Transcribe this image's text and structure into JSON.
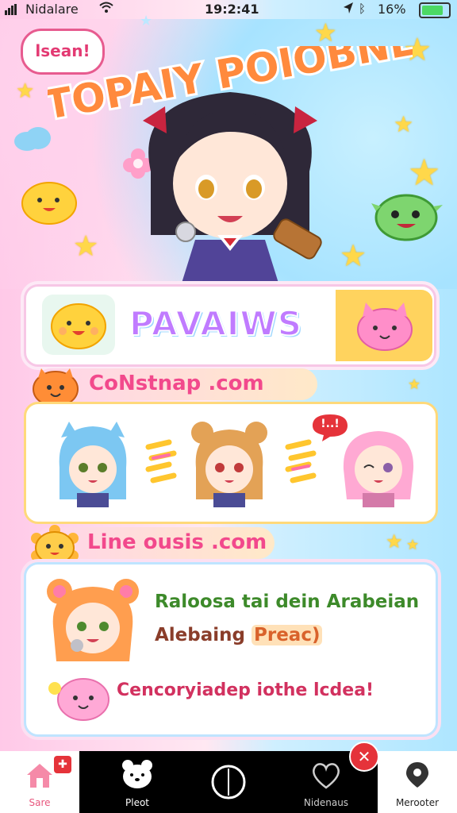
{
  "status": {
    "carrier": "Nidalare",
    "time": "19:2:41",
    "battery": "16%"
  },
  "hero": {
    "speech_bubble": "lsean!",
    "title": "TOPAIY POIOBNE"
  },
  "feature_panel": {
    "label": "PAVAIWS"
  },
  "section_one": {
    "title": "CoNstnap .com"
  },
  "section_two": {
    "title": "Line ousis .com"
  },
  "message_panel": {
    "line1": "Raloosa tai dein Arabeian",
    "line2_prefix": "Alebaing ",
    "line2_highlight": "Preac)",
    "line3": "Cencoryiadep iothe lcdea!"
  },
  "red_bubble": "!..!",
  "tabs": [
    {
      "label": "Sare",
      "icon": "home-icon"
    },
    {
      "label": "Pleot",
      "icon": "bear-icon"
    },
    {
      "label": "",
      "icon": "circle-icon"
    },
    {
      "label": "Nidenaus",
      "icon": "heart-icon"
    },
    {
      "label": "Merooter",
      "icon": "pin-icon"
    }
  ],
  "colors": {
    "accent_pink": "#f2498c",
    "tab_bar": "#000000",
    "badge_red": "#e5333a"
  }
}
